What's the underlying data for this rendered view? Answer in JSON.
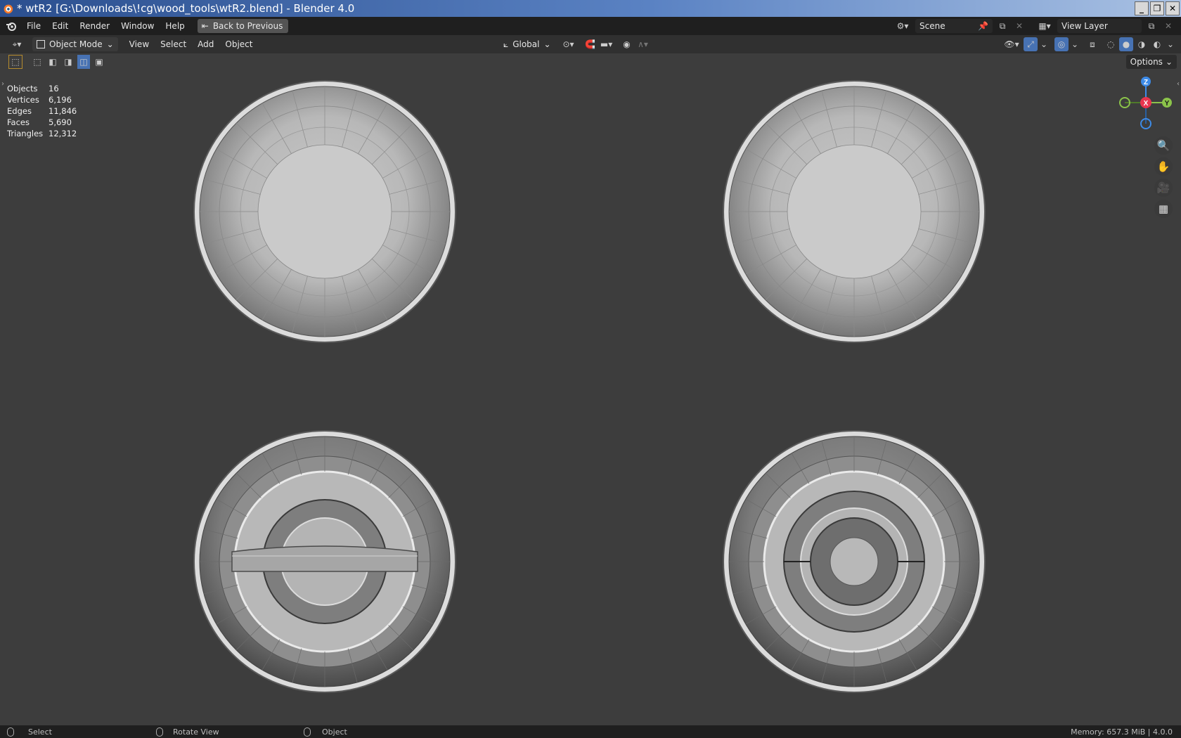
{
  "window": {
    "title": "* wtR2 [G:\\Downloads\\!cg\\wood_tools\\wtR2.blend] - Blender 4.0",
    "buttons": [
      "minimize",
      "restore",
      "close"
    ]
  },
  "menubar": {
    "items": [
      "File",
      "Edit",
      "Render",
      "Window",
      "Help"
    ],
    "back_button": "Back to Previous",
    "scene_field": "Scene",
    "view_layer_field": "View Layer"
  },
  "header": {
    "mode": "Object Mode",
    "menus": [
      "View",
      "Select",
      "Add",
      "Object"
    ],
    "transform_orientation": "Global"
  },
  "viewport": {
    "options_label": "Options",
    "stats": [
      {
        "label": "Objects",
        "value": "16"
      },
      {
        "label": "Vertices",
        "value": "6,196"
      },
      {
        "label": "Edges",
        "value": "11,846"
      },
      {
        "label": "Faces",
        "value": "5,690"
      },
      {
        "label": "Triangles",
        "value": "12,312"
      }
    ],
    "gizmo": {
      "z": "Z",
      "x": "X",
      "y": "Y"
    }
  },
  "statusbar": {
    "select": "Select",
    "rotate": "Rotate View",
    "object": "Object",
    "memory": "Memory: 657.3 MiB | 4.0.0"
  },
  "colors": {
    "viewport_bg": "#3d3d3d",
    "axis_x": "#e8354f",
    "axis_y": "#8bc34a",
    "axis_z": "#3d8be8",
    "title_gradient_start": "#2b4f8f"
  }
}
